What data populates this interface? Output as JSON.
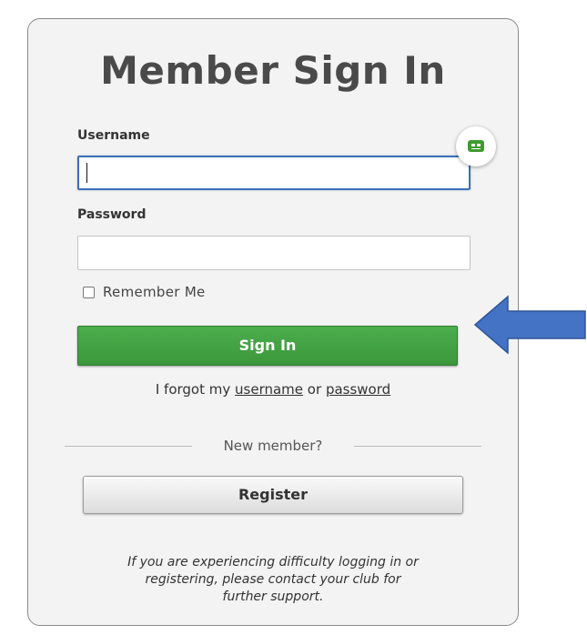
{
  "title": "Member Sign In",
  "form": {
    "username_label": "Username",
    "username_value": "",
    "password_label": "Password",
    "password_value": "",
    "remember_label": "Remember Me",
    "remember_checked": false,
    "signin_label": "Sign In"
  },
  "forgot": {
    "prefix": "I forgot my",
    "username_link": "username",
    "connector": "or",
    "password_link": "password"
  },
  "new_member": {
    "divider_label": "New member?",
    "register_label": "Register"
  },
  "footnote": {
    "line1": "If you are experiencing difficulty logging in or",
    "line2": "registering, please contact your club for",
    "line3": "further support."
  },
  "icons": {
    "helper": "password-manager-icon",
    "arrow": "arrow-left-icon"
  },
  "colors": {
    "signin_button": "#44a544",
    "arrow": "#4472c4",
    "focus_border": "#3b6fb6"
  }
}
